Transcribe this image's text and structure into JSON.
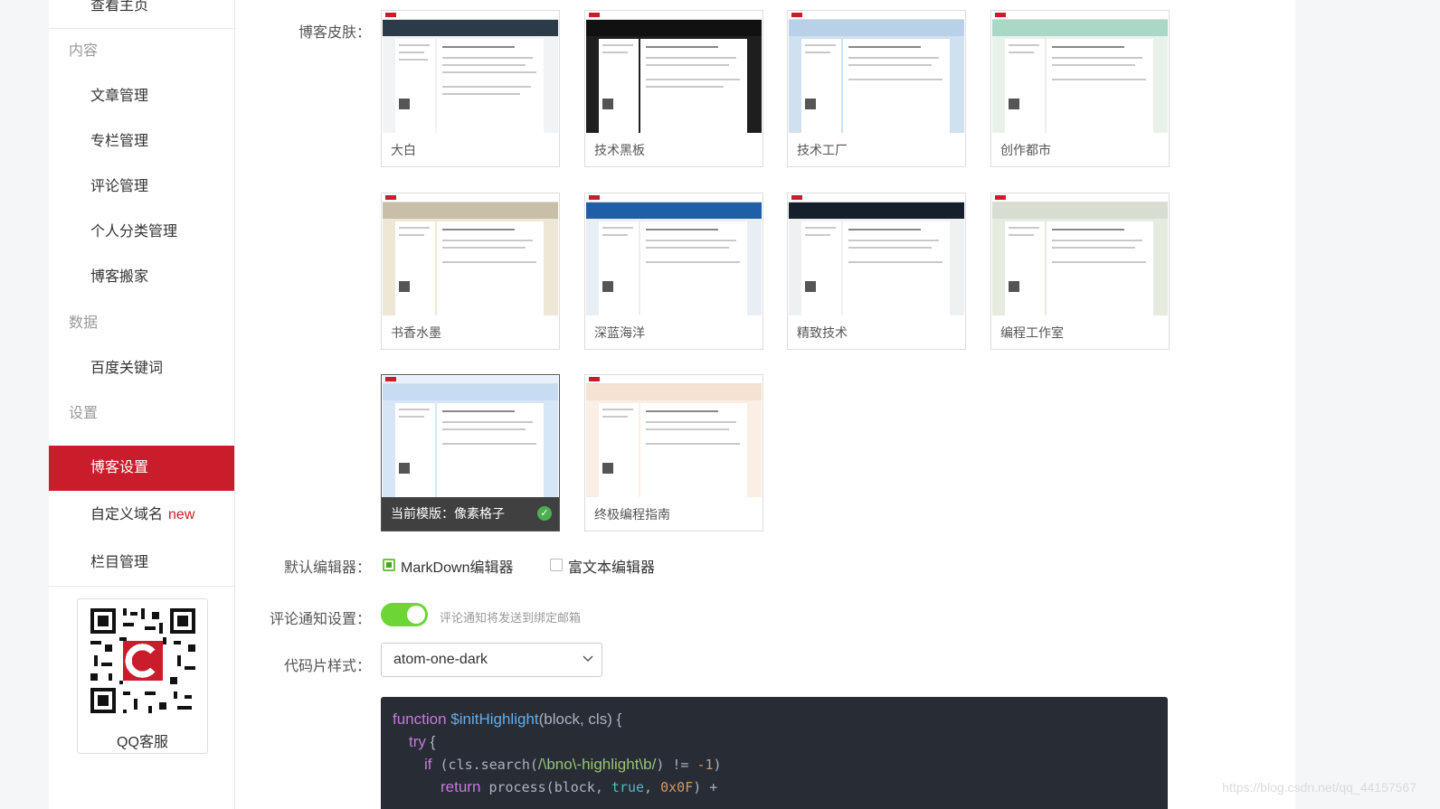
{
  "sidebar": {
    "view_home": "查看主页",
    "groups": {
      "content": "内容",
      "data": "数据",
      "settings": "设置"
    },
    "items": {
      "articles": "文章管理",
      "columns": "专栏管理",
      "comments": "评论管理",
      "categories": "个人分类管理",
      "blog_move": "博客搬家",
      "baidu_keywords": "百度关键词",
      "blog_settings": "博客设置",
      "custom_domain": "自定义域名",
      "custom_domain_badge": "new",
      "column_mgmt": "栏目管理"
    },
    "qr_label": "QQ客服"
  },
  "form": {
    "skin_label": "博客皮肤：",
    "editor_label": "默认编辑器：",
    "notify_label": "评论通知设置：",
    "code_style_label": "代码片样式："
  },
  "skins": [
    {
      "name": "大白"
    },
    {
      "name": "技术黑板"
    },
    {
      "name": "技术工厂"
    },
    {
      "name": "创作都市"
    },
    {
      "name": "书香水墨"
    },
    {
      "name": "深蓝海洋"
    },
    {
      "name": "精致技术"
    },
    {
      "name": "编程工作室"
    },
    {
      "name": "当前模版：像素格子"
    },
    {
      "name": "终极编程指南"
    }
  ],
  "editor": {
    "markdown": "MarkDown编辑器",
    "richtext": "富文本编辑器",
    "selected": "markdown"
  },
  "notify": {
    "enabled": true,
    "hint": "评论通知将发送到绑定邮箱"
  },
  "code_style": {
    "value": "atom-one-dark"
  },
  "code_preview": {
    "l1_kw": "function",
    "l1_fn": "$initHighlight",
    "l1_rest": "(block, cls) {",
    "l2_kw": "try",
    "l2_rest": " {",
    "l3_kw": "if",
    "l3_a": " (cls.search(",
    "l3_str": "/\\bno\\-highlight\\b/",
    "l3_b": ") != ",
    "l3_num": "-1",
    "l3_c": ")",
    "l4_kw": "return",
    "l4_a": " process(block, ",
    "l4_lit": "true",
    "l4_b": ", ",
    "l4_num": "0x0F",
    "l4_c": ") +"
  },
  "watermark": "https://blog.csdn.net/qq_44157567"
}
